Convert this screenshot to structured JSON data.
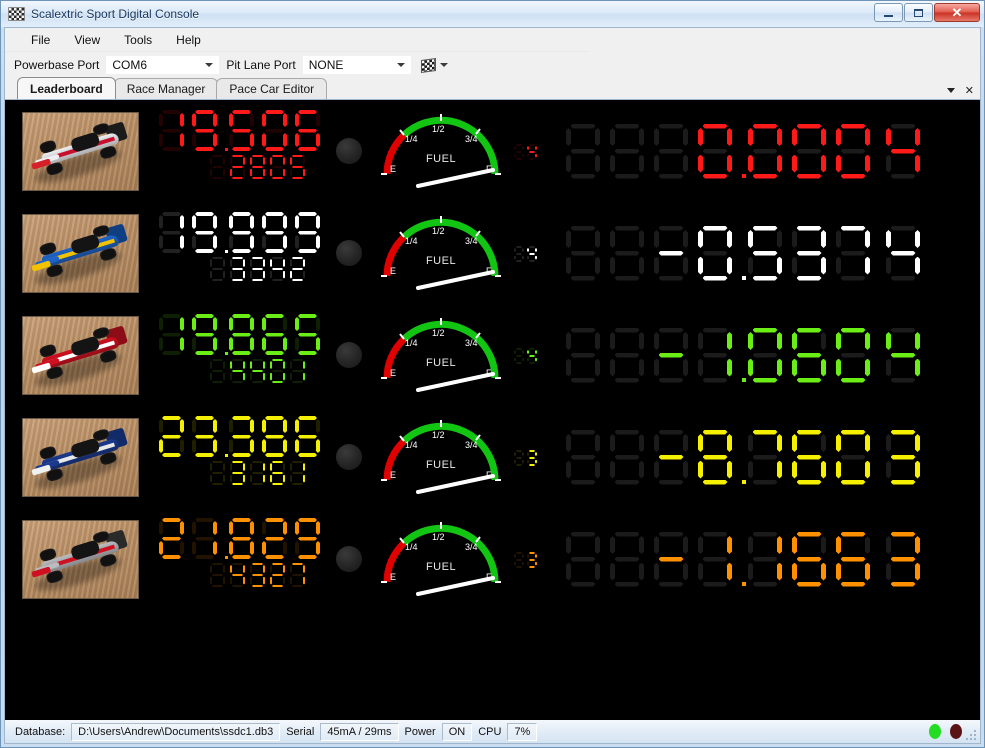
{
  "window": {
    "title": "Scalextric Sport Digital Console",
    "icon": "checkered-flag-icon",
    "minimize_label": "Minimize",
    "maximize_label": "Maximize",
    "close_label": "Close"
  },
  "menu": {
    "items": [
      {
        "label": "File"
      },
      {
        "label": "View"
      },
      {
        "label": "Tools"
      },
      {
        "label": "Help"
      }
    ]
  },
  "toolbar": {
    "powerbase_port_label": "Powerbase Port",
    "powerbase_port_value": "COM6",
    "pit_lane_port_label": "Pit Lane Port",
    "pit_lane_port_value": "NONE",
    "flag_button_name": "checkered-flag-button"
  },
  "tabs": {
    "items": [
      {
        "label": "Leaderboard",
        "active": true
      },
      {
        "label": "Race Manager",
        "active": false
      },
      {
        "label": "Pace Car Editor",
        "active": false
      }
    ],
    "dropdown_icon": "chevron-down-icon",
    "close_icon": "close-icon"
  },
  "leaderboard": {
    "rows": [
      {
        "position": 1,
        "color": "#ff1a1a",
        "car_name": "car-white-red",
        "car_colors": {
          "body": "#eceff2",
          "accent": "#d61f26",
          "wing": "#1b1b1b",
          "stripe": "#c8102e"
        },
        "lap_time": "19.506",
        "lap_time_digits": "19.506",
        "best_or_total": "2805",
        "fuel_percent": 100,
        "fuel_label": "FUEL",
        "laps_remaining": "4",
        "gap": "0.000",
        "gap_digits": "0.000",
        "car_id": "4"
      },
      {
        "position": 2,
        "color": "#ffffff",
        "car_name": "car-blue-yellow",
        "car_colors": {
          "body": "#1e64c8",
          "accent": "#f2c200",
          "wing": "#0f3f82",
          "stripe": "#f2c200"
        },
        "lap_time": "19.999",
        "lap_time_digits": "19.999",
        "best_or_total": "3342",
        "fuel_percent": 100,
        "fuel_label": "FUEL",
        "laps_remaining": "4",
        "gap": "-0.537",
        "gap_digits": "-0.537",
        "car_id": "4"
      },
      {
        "position": 3,
        "color": "#6aee16",
        "car_name": "car-red",
        "car_colors": {
          "body": "#cf1020",
          "accent": "#ffffff",
          "wing": "#8c0d16",
          "stripe": "#ffffff"
        },
        "lap_time": "19.865",
        "lap_time_digits": "19.865",
        "best_or_total": "4401",
        "fuel_percent": 100,
        "fuel_label": "FUEL",
        "laps_remaining": "4",
        "gap": "-1.060",
        "gap_digits": "-1.060",
        "car_id": "4"
      },
      {
        "position": 4,
        "color": "#f5f000",
        "car_name": "car-blue-white",
        "car_colors": {
          "body": "#1b3a8f",
          "accent": "#f0f0f0",
          "wing": "#122a68",
          "stripe": "#e8e8e8"
        },
        "lap_time": "23.386",
        "lap_time_digits": "23.386",
        "best_or_total": "3161",
        "fuel_percent": 100,
        "fuel_label": "FUEL",
        "laps_remaining": "3",
        "gap": "-8.760",
        "gap_digits": "-8.760",
        "car_id": "3"
      },
      {
        "position": 5,
        "color": "#ff9000",
        "car_name": "car-silver-red",
        "car_colors": {
          "body": "#b9bcc0",
          "accent": "#cf1020",
          "wing": "#2a2a2a",
          "stripe": "#cf1020"
        },
        "lap_time": "21.829",
        "lap_time_digits": "21.829",
        "best_or_total": "4327",
        "fuel_percent": 100,
        "fuel_label": "FUEL",
        "laps_remaining": "3",
        "gap": "-1.166",
        "gap_digits": "-1.166",
        "car_id": "3"
      }
    ],
    "gauge": {
      "label": "FUEL",
      "ticks": [
        "E",
        "1/4",
        "1/2",
        "3/4",
        "F"
      ],
      "empty_zone_color": "#e00000",
      "full_zone_color": "#12c512"
    }
  },
  "statusbar": {
    "database_label": "Database:",
    "database_path": "D:\\Users\\Andrew\\Documents\\ssdc1.db3",
    "serial_label": "Serial",
    "serial_value": "45mA / 29ms",
    "power_label": "Power",
    "power_value": "ON",
    "cpu_label": "CPU",
    "cpu_value": "7%",
    "led_green": "#22dd22",
    "led_dark": "#5a1414"
  }
}
